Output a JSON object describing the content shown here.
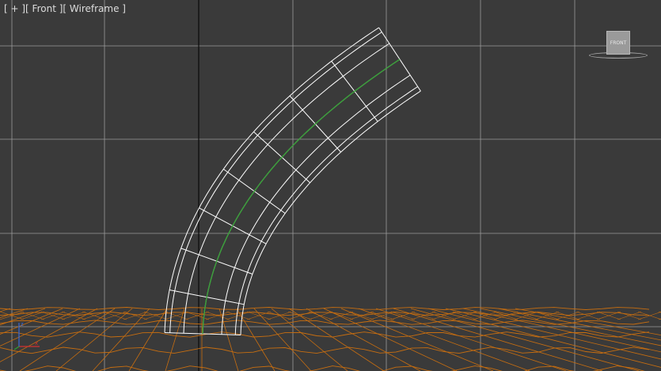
{
  "viewport": {
    "label_plus": "[ + ]",
    "label_view": "[ Front ]",
    "label_shading": "[ Wireframe ]"
  },
  "viewcube": {
    "face": "FRONT"
  },
  "colors": {
    "background": "#3a3a3a",
    "grid": "#9a9a9a",
    "grid_axis": "#0a0a0a",
    "tube_wire": "#ffffff",
    "tube_spline": "#3aa03a",
    "ground_wire": "#c86e10"
  },
  "icons": [
    "viewcube-icon",
    "axis-tripod-icon"
  ]
}
